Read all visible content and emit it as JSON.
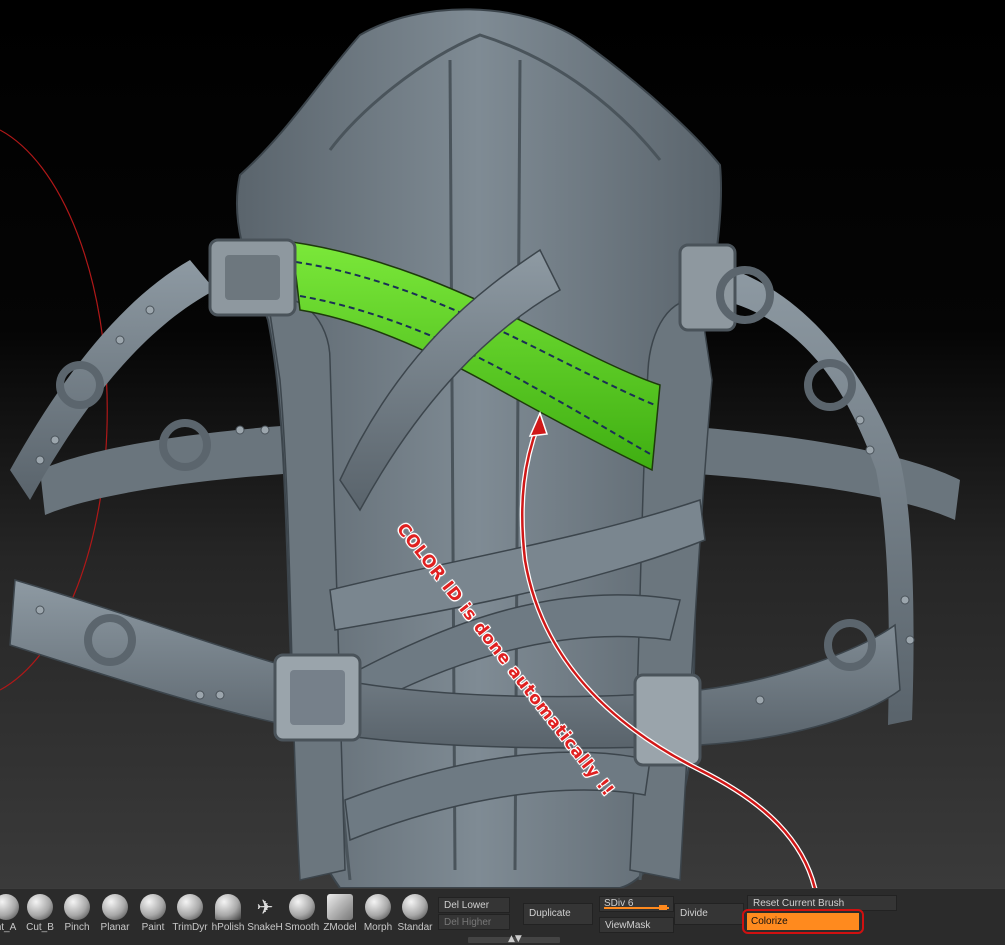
{
  "viewport": {
    "annotation": "COLOR ID is done automatically !!",
    "highlight_color": "#5fd422",
    "mesh_color": "#7c8891",
    "annotation_color": "#e02020"
  },
  "brush_palette": {
    "brushes": [
      {
        "label": "nt_A",
        "icon": "clay-sphere-icon"
      },
      {
        "label": "Cut_B",
        "icon": "clay-sphere-icon"
      },
      {
        "label": "Pinch",
        "icon": "pinch-icon"
      },
      {
        "label": "Planar",
        "icon": "planar-icon"
      },
      {
        "label": "Paint",
        "icon": "spiral-icon"
      },
      {
        "label": "TrimDyr",
        "icon": "sphere-icon"
      },
      {
        "label": "hPolish",
        "icon": "cone-icon"
      },
      {
        "label": "SnakeH",
        "icon": "snake-hook-icon"
      },
      {
        "label": "Smooth",
        "icon": "sphere-icon"
      },
      {
        "label": "ZModel",
        "icon": "cube-icon"
      },
      {
        "label": "Morph",
        "icon": "sphere-icon"
      },
      {
        "label": "Standar",
        "icon": "sphere-icon"
      }
    ]
  },
  "geometry": {
    "del_lower": "Del Lower",
    "del_higher": "Del Higher",
    "duplicate": "Duplicate",
    "sdiv_label": "SDiv 6",
    "sdiv_value": 6,
    "viewmask": "ViewMask",
    "divide": "Divide",
    "reset_current_brush": "Reset Current Brush",
    "colorize": "Colorize"
  },
  "colors": {
    "accent": "#ff8a1e",
    "highlight_ring": "#d01010"
  }
}
